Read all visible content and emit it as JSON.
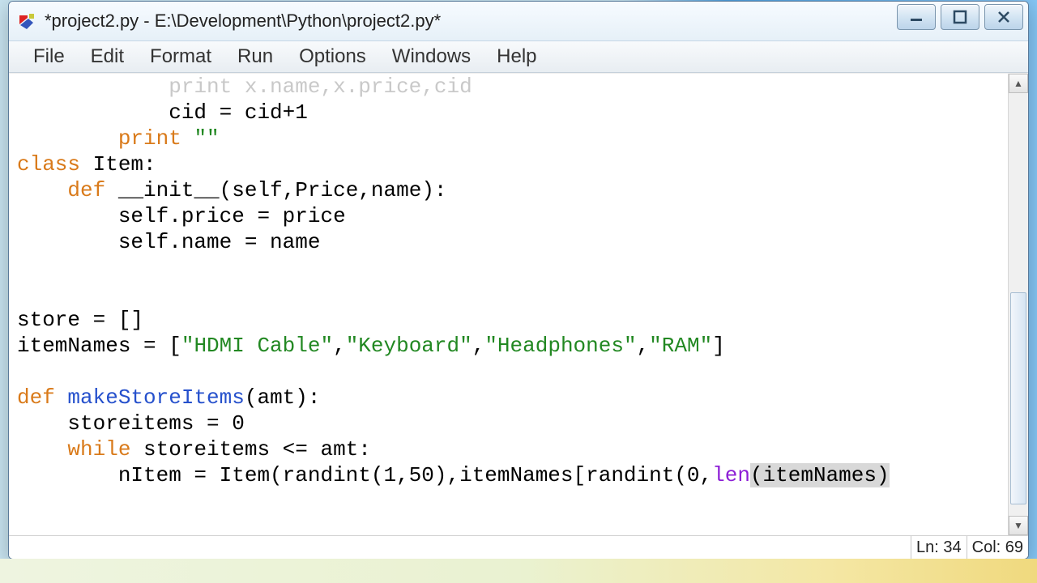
{
  "window": {
    "title": "*project2.py - E:\\Development\\Python\\project2.py*"
  },
  "menubar": {
    "items": [
      "File",
      "Edit",
      "Format",
      "Run",
      "Options",
      "Windows",
      "Help"
    ]
  },
  "code": {
    "cutoff_print": "print",
    "cutoff_rest": " x.name,x.price,cid",
    "l1": "            cid = cid+1",
    "l2_print": "print",
    "l2_indent": "        ",
    "l2_str": " \"\"",
    "l3_class": "class",
    "l3_rest": " Item:",
    "l4_indent": "    ",
    "l4_def": "def",
    "l4_name": " __init__",
    "l4_rest": "(self,Price,name):",
    "l5": "        self.price = price",
    "l6": "        self.name = name",
    "blank": "",
    "l7": "store = []",
    "l8_a": "itemNames = [",
    "l8_s1": "\"HDMI Cable\"",
    "l8_c": ",",
    "l8_s2": "\"Keyboard\"",
    "l8_s3": "\"Headphones\"",
    "l8_s4": "\"RAM\"",
    "l8_end": "]",
    "l9_def": "def",
    "l9_name": " makeStoreItems",
    "l9_rest": "(amt):",
    "l10": "    storeitems = 0",
    "l11_indent": "    ",
    "l11_while": "while",
    "l11_rest": " storeitems <= amt:",
    "l12_a": "        nItem = Item(randint(1,50),itemNames[randint(0,",
    "l12_len": "len",
    "l12_sel": "(itemNames)"
  },
  "status": {
    "ln": "Ln: 34",
    "col": "Col: 69"
  }
}
